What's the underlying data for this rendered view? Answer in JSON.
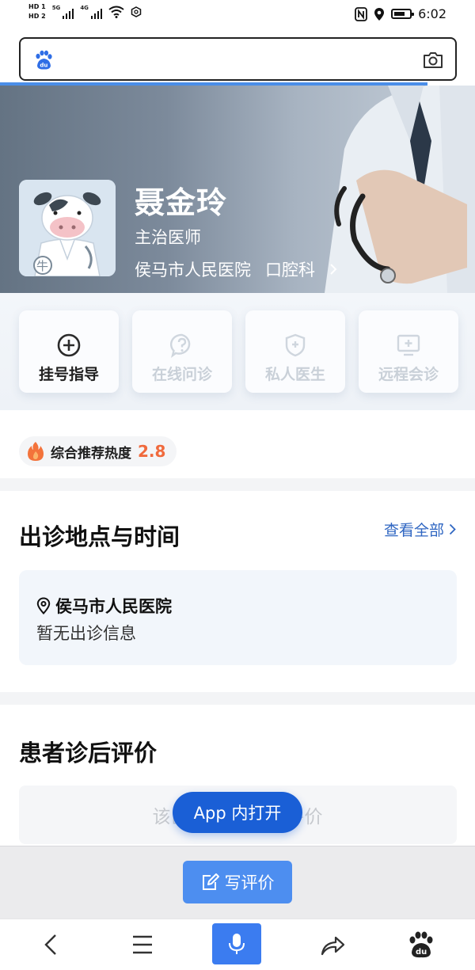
{
  "status_bar": {
    "sim1": "HD 1",
    "sim2": "HD 2",
    "net1": "5G",
    "net2": "4G",
    "time": "6:02"
  },
  "search": {
    "placeholder": ""
  },
  "doctor": {
    "name": "聂金玲",
    "title": "主治医师",
    "hospital": "侯马市人民医院",
    "department": "口腔科",
    "avatar_badge": "牛"
  },
  "services": [
    {
      "label": "挂号指导",
      "icon": "plus-circle-icon",
      "active": true
    },
    {
      "label": "在线问诊",
      "icon": "question-bubble-icon",
      "active": false
    },
    {
      "label": "私人医生",
      "icon": "shield-plus-icon",
      "active": false
    },
    {
      "label": "远程会诊",
      "icon": "monitor-plus-icon",
      "active": false
    }
  ],
  "heat": {
    "label": "综合推荐热度",
    "score": "2.8"
  },
  "schedule": {
    "title": "出诊地点与时间",
    "view_all": "查看全部",
    "location": "侯马市人民医院",
    "info": "暂无出诊信息"
  },
  "reviews": {
    "title": "患者诊后评价",
    "empty": "该医生暂无诊后评价",
    "app_open": "App 内打开"
  },
  "write_review": {
    "label": "写评价"
  },
  "colors": {
    "accent": "#1a5fd6",
    "write_button": "#4d8ef0",
    "heat_score": "#f06a3d",
    "link": "#2f66c2"
  }
}
